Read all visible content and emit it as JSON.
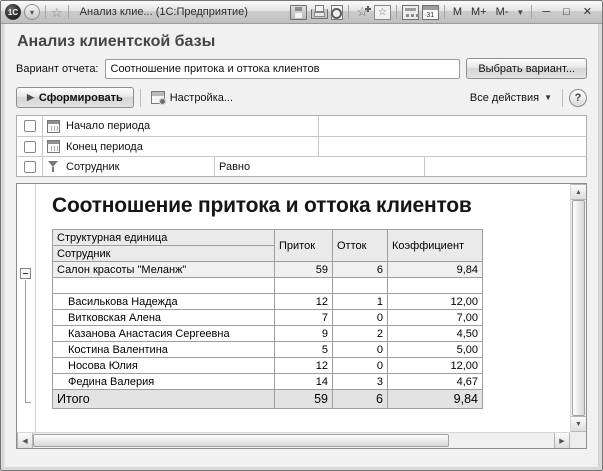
{
  "window": {
    "title": "Анализ клие...  (1С:Предприятие)",
    "memory_buttons": [
      "M",
      "M+",
      "M-"
    ]
  },
  "icons": {
    "logo_text": "1С",
    "star": "☆",
    "dropdown_small": "▾",
    "play": "▶",
    "up": "▲",
    "down": "▼",
    "left": "◀",
    "right": "▶",
    "minimize": "─",
    "maximize": "□",
    "close": "✕",
    "help": "?",
    "calendar_day": "31"
  },
  "header": {
    "page_title": "Анализ клиентской базы",
    "variant_label": "Вариант отчета:",
    "variant_value": "Соотношение притока и оттока клиентов",
    "choose_variant_button": "Выбрать вариант..."
  },
  "toolbar": {
    "generate_button": "Сформировать",
    "settings_button": "Настройка...",
    "all_actions_button": "Все действия"
  },
  "filters": {
    "rows": [
      {
        "label": "Начало периода",
        "condition": "",
        "value": ""
      },
      {
        "label": "Конец периода",
        "condition": "",
        "value": ""
      },
      {
        "label": "Сотрудник",
        "condition": "Равно",
        "value": ""
      }
    ]
  },
  "report": {
    "title": "Соотношение притока и оттока клиентов",
    "table": {
      "columns": [
        "Структурная единица",
        "Приток",
        "Отток",
        "Коэффициент"
      ],
      "subheader": "Сотрудник",
      "group_row": {
        "name": "Салон красоты \"Меланж\"",
        "inflow": "59",
        "outflow": "6",
        "ratio": "9,84"
      },
      "rows": [
        {
          "name": "Василькова Надежда",
          "inflow": "12",
          "outflow": "1",
          "ratio": "12,00"
        },
        {
          "name": "Витковская Алена",
          "inflow": "7",
          "outflow": "0",
          "ratio": "7,00"
        },
        {
          "name": "Казанова Анастасия Сергеевна",
          "inflow": "9",
          "outflow": "2",
          "ratio": "4,50"
        },
        {
          "name": "Костина Валентина",
          "inflow": "5",
          "outflow": "0",
          "ratio": "5,00"
        },
        {
          "name": "Носова Юлия",
          "inflow": "12",
          "outflow": "0",
          "ratio": "12,00"
        },
        {
          "name": "Федина Валерия",
          "inflow": "14",
          "outflow": "3",
          "ratio": "4,67"
        }
      ],
      "total_row": {
        "name": "Итого",
        "inflow": "59",
        "outflow": "6",
        "ratio": "9,84"
      }
    }
  }
}
